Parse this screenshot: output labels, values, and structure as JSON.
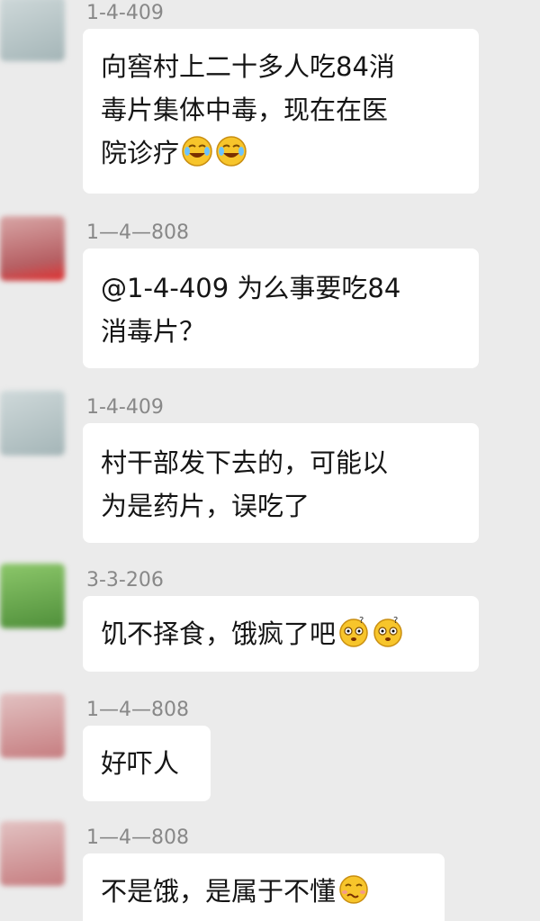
{
  "messages": [
    {
      "sender": "1-4-409",
      "lines": [
        "向窖村上二十多人吃84消",
        "毒片集体中毒，现在在医",
        "院诊疗"
      ],
      "emojis": [
        "laugh-cry-emoji",
        "laugh-cry-emoji"
      ],
      "avatar_color": "#b9c7c9"
    },
    {
      "sender": "1—4—808",
      "lines": [
        "@1-4-409 为么事要吃84",
        "消毒片？"
      ],
      "emojis": [],
      "avatar_color": "#c9898b"
    },
    {
      "sender": "1-4-409",
      "lines": [
        "村干部发下去的，可能以",
        "为是药片，误吃了"
      ],
      "emojis": [],
      "avatar_color": "#b9c7c9"
    },
    {
      "sender": "3-3-206",
      "lines": [
        "饥不择食，饿疯了吧"
      ],
      "emojis": [
        "dizzy-emoji",
        "dizzy-emoji"
      ],
      "avatar_color": "#6aa650"
    },
    {
      "sender": "1—4—808",
      "lines": [
        "好吓人"
      ],
      "emojis": [],
      "avatar_color": "#c9898b"
    },
    {
      "sender": "1—4—808",
      "lines": [
        "不是饿，是属于不懂"
      ],
      "emojis": [
        "woozy-emoji"
      ],
      "avatar_color": "#c9898b"
    }
  ]
}
